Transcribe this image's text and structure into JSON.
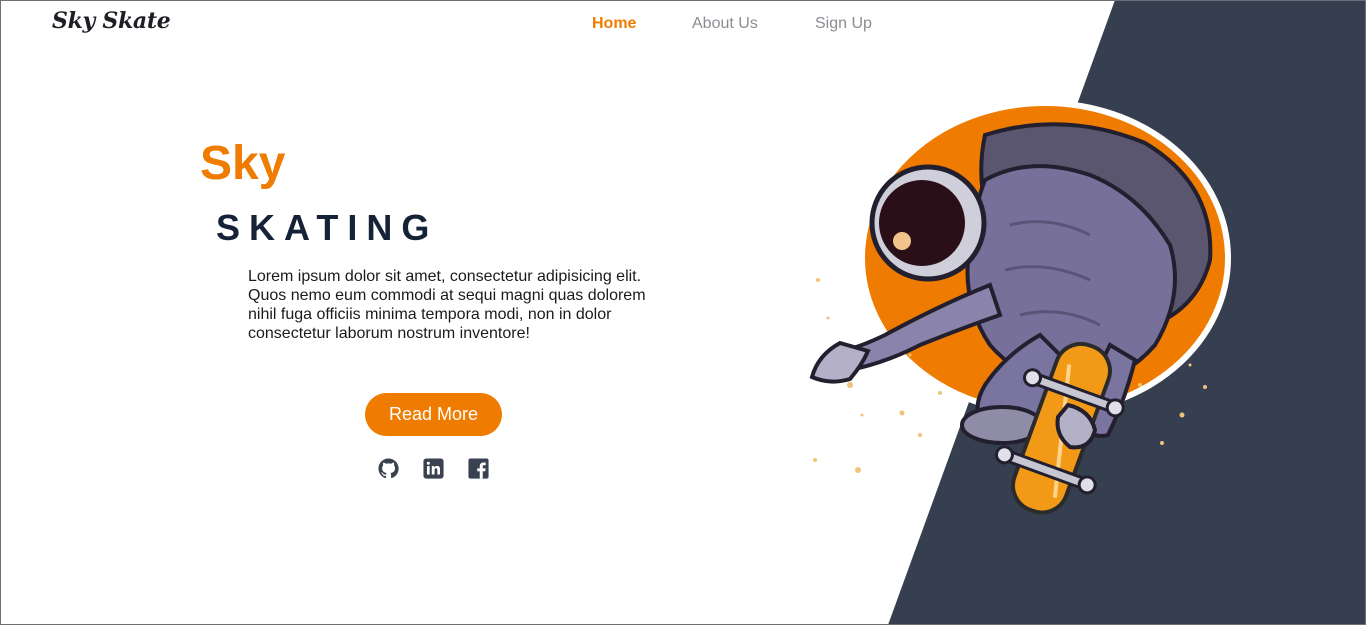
{
  "brand": {
    "name": "Sky Skate"
  },
  "nav": {
    "items": [
      {
        "label": "Home",
        "active": true
      },
      {
        "label": "About Us",
        "active": false
      },
      {
        "label": "Sign Up",
        "active": false
      }
    ]
  },
  "hero": {
    "title_line1": "Sky",
    "title_line2": "SKATING",
    "description": "Lorem ipsum dolor sit amet, consectetur adipisicing elit. Quos nemo eum commodi at sequi magni quas dolorem nihil fuga officiis minima tempora modi, non in dolor consectetur laborum nostrum inventore!",
    "button_label": "Read More"
  },
  "socials": [
    {
      "icon": "github-icon"
    },
    {
      "icon": "linkedin-icon"
    },
    {
      "icon": "facebook-icon"
    }
  ],
  "colors": {
    "accent": "#ef7c00",
    "dark_panel": "#353f4f",
    "heading_dark": "#152238",
    "nav_muted": "#8a8d93"
  }
}
